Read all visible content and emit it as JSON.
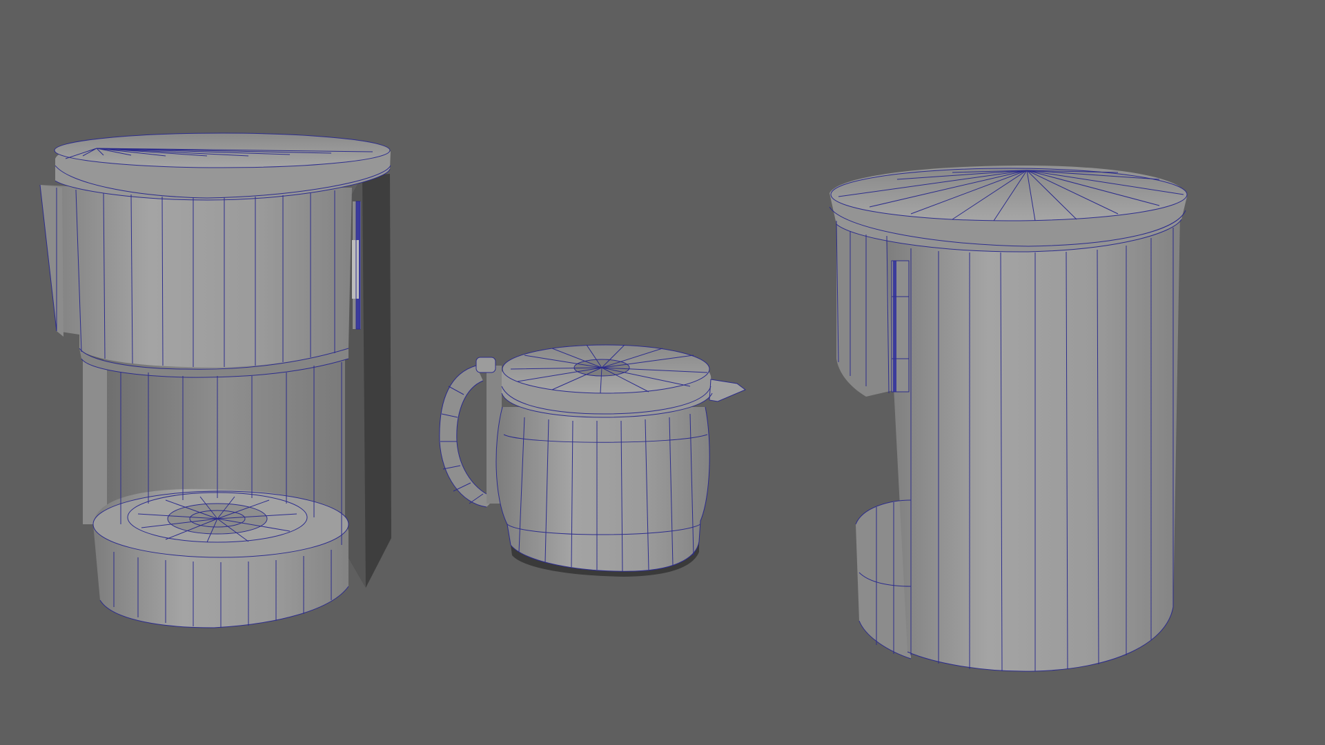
{
  "viewport": {
    "background": "#5f5f5f",
    "mesh_fill": "#9a9a9a",
    "mesh_fill_dark": "#7a7a7a",
    "mesh_shadow": "#3c3c3c",
    "wire_color": "#2c2c8c"
  },
  "objects": [
    {
      "name": "coffee-maker-base"
    },
    {
      "name": "coffee-carafe"
    },
    {
      "name": "coffee-maker-canister"
    }
  ]
}
